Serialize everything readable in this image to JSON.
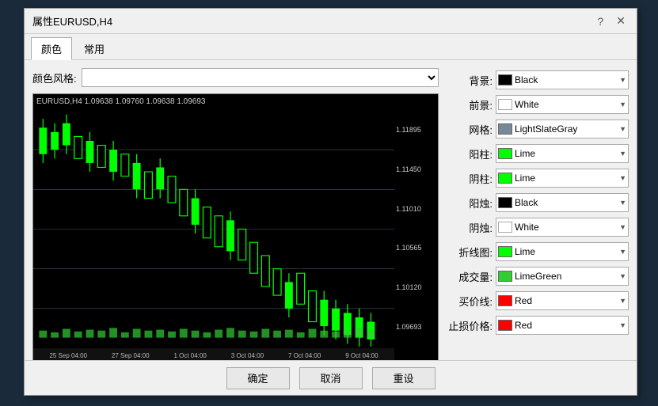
{
  "dialog": {
    "title": "属性EURUSD,H4",
    "help_label": "?",
    "close_label": "✕"
  },
  "tabs": [
    {
      "id": "color",
      "label": "颜色",
      "active": true
    },
    {
      "id": "common",
      "label": "常用",
      "active": false
    }
  ],
  "color_style": {
    "label": "颜色风格:",
    "value": "",
    "placeholder": ""
  },
  "chart_header": "EURUSD,H4  1.09638  1.09760  1.09638  1.09693",
  "price_labels": [
    "1.11895",
    "1.11450",
    "1.11010",
    "1.10565",
    "1.10120",
    "1.09693"
  ],
  "date_labels": [
    "25 Sep 04:00",
    "27 Sep 04:00",
    "1 Oct 04:00",
    "3 Oct 04:00",
    "7 Oct 04:00",
    "9 Oct 04:00"
  ],
  "properties": [
    {
      "id": "background",
      "label": "背景:",
      "color": "#000000",
      "value": "Black"
    },
    {
      "id": "foreground",
      "label": "前景:",
      "color": "#ffffff",
      "value": "White"
    },
    {
      "id": "grid",
      "label": "网格:",
      "color": "#778899",
      "value": "LightSlateGray"
    },
    {
      "id": "bull_candle",
      "label": "阳柱:",
      "color": "#00ff00",
      "value": "Lime"
    },
    {
      "id": "bear_candle",
      "label": "阴柱:",
      "color": "#00ff00",
      "value": "Lime"
    },
    {
      "id": "bull_wick",
      "label": "阳烛:",
      "color": "#000000",
      "value": "Black"
    },
    {
      "id": "bear_wick",
      "label": "阴烛:",
      "color": "#ffffff",
      "value": "White"
    },
    {
      "id": "line_chart",
      "label": "折线图:",
      "color": "#00ff00",
      "value": "Lime"
    },
    {
      "id": "volume",
      "label": "成交量:",
      "color": "#32cd32",
      "value": "LimeGreen"
    },
    {
      "id": "ask_line",
      "label": "买价线:",
      "color": "#ff0000",
      "value": "Red"
    },
    {
      "id": "stop_price",
      "label": "止损价格:",
      "color": "#ff0000",
      "value": "Red"
    }
  ],
  "footer": {
    "confirm": "确定",
    "cancel": "取消",
    "reset": "重设"
  }
}
